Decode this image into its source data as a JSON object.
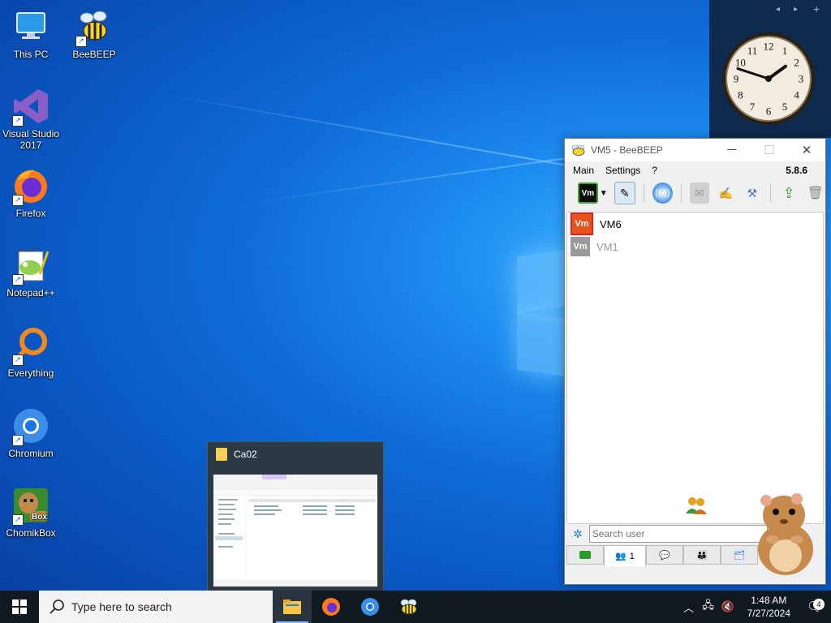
{
  "desktop": {
    "icons": [
      {
        "label": "This PC",
        "icon": "monitor-icon"
      },
      {
        "label": "BeeBEEP",
        "icon": "bee-icon"
      },
      {
        "label": "Visual Studio 2017",
        "icon": "visual-studio-icon"
      },
      {
        "label": "Firefox",
        "icon": "firefox-icon"
      },
      {
        "label": "Notepad++",
        "icon": "notepadpp-icon"
      },
      {
        "label": "Everything",
        "icon": "everything-icon"
      },
      {
        "label": "Chromium",
        "icon": "chromium-icon"
      },
      {
        "label": "ChomikBox",
        "icon": "chomikbox-icon"
      }
    ]
  },
  "clock_gadget": {
    "numbers": [
      "12",
      "1",
      "2",
      "3",
      "4",
      "5",
      "6",
      "7",
      "8",
      "9",
      "10",
      "11"
    ],
    "hour": 1,
    "minute": 48
  },
  "beebeep": {
    "title": "VM5 - BeeBEEP",
    "menu": [
      "Main",
      "Settings",
      "?"
    ],
    "version": "5.8.6",
    "users": [
      {
        "name": "VM6",
        "badge": "Vm",
        "online": true,
        "color": "#e8531e"
      },
      {
        "name": "VM1",
        "badge": "Vm",
        "online": false,
        "color": "#9a9a9a"
      }
    ],
    "search_placeholder": "Search user",
    "tab_users_count": "1"
  },
  "thumbnail": {
    "title": "Ca02"
  },
  "taskbar": {
    "search_placeholder": "Type here to search",
    "time": "1:48 AM",
    "date": "7/27/2024",
    "notification_count": "4"
  }
}
